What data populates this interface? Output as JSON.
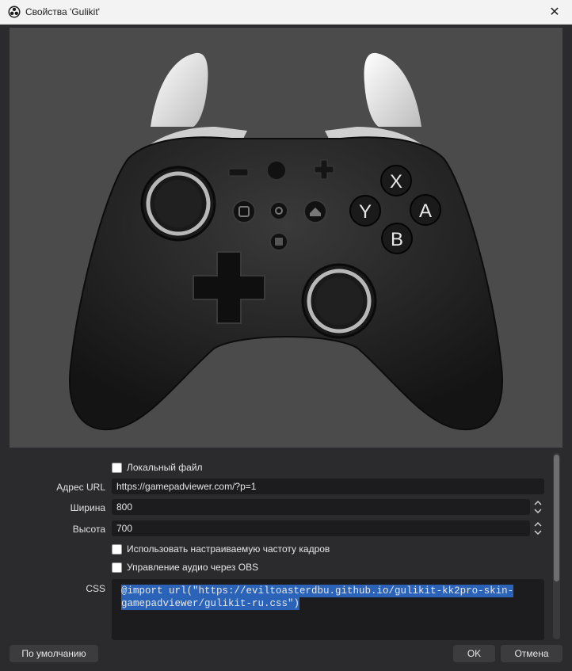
{
  "window": {
    "title": "Свойства 'Gulikit'",
    "close_glyph": "✕",
    "app_icon": "obs-logo-icon"
  },
  "preview": {
    "controller_buttons": {
      "x": "X",
      "y": "Y",
      "a": "A",
      "b": "B"
    }
  },
  "form": {
    "local_file_label": "Локальный файл",
    "url_label": "Адрес URL",
    "url_value": "https://gamepadviewer.com/?p=1",
    "width_label": "Ширина",
    "width_value": "800",
    "height_label": "Высота",
    "height_value": "700",
    "custom_fps_label": "Использовать настраиваемую частоту кадров",
    "audio_obs_label": "Управление аудио через OBS",
    "css_label": "CSS",
    "css_lines": [
      "@import url(\"https://eviltoasterdbu.github.io/gulikit-kk2pro-skin-",
      "gamepadviewer/gulikit-ru.css\")"
    ]
  },
  "buttons": {
    "defaults": "По умолчанию",
    "ok": "OK",
    "cancel": "Отмена"
  },
  "colors": {
    "background": "#2b2b2d",
    "field": "#1c1c1e",
    "selection": "#2a63b7",
    "preview_bg": "#4b4b4b"
  }
}
